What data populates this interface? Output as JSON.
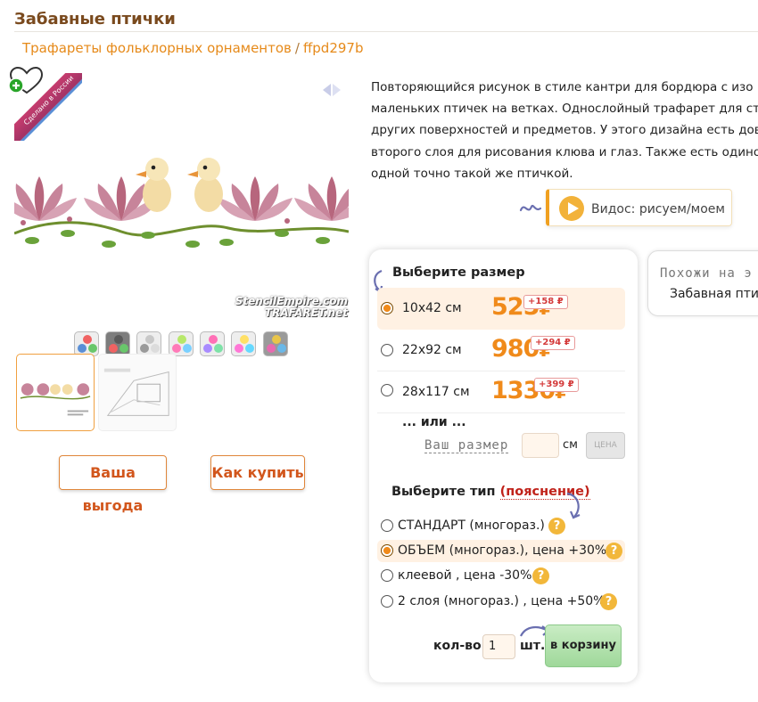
{
  "header": {
    "title": "Забавные птички",
    "breadcrumb": {
      "category": "Трафареты фольклорных орнаментов",
      "separator": "/",
      "sku": "ffpd297b"
    }
  },
  "gallery": {
    "ribbon_text": "Сделано в России",
    "watermark_line1": "StencilEmpire.com",
    "watermark_line2": "TRAFARET.net",
    "swatches": [
      [
        "#f06262",
        "#5a8fd6",
        "#69c76b"
      ],
      [
        "#5a5a5a",
        "#f06262",
        "#69c76b"
      ],
      [
        "#c8c8c8",
        "#9a9a9a",
        "#dcdcdc"
      ],
      [
        "#b7e86a",
        "#ff7ab8",
        "#7ad0ff"
      ],
      [
        "#ff6fb6",
        "#a98bff",
        "#7ee2a8"
      ],
      [
        "#ffe066",
        "#ff77d6",
        "#66d9ff"
      ],
      [
        "#e8c54a",
        "#e86ab0",
        "#6ab8e8"
      ]
    ],
    "thumb_caption": "Забавные птички"
  },
  "buttons": {
    "benefit": "Ваша выгода",
    "how_to_buy": "Как купить"
  },
  "description": {
    "lines": [
      "Повторяющийся рисунок в стиле кантри для бордюра с изо",
      "маленьких птичек на ветках. Однослойный трафарет для ст",
      "других поверхностей и предметов. У этого дизайна есть дов",
      "второго слоя для рисования клюва и глаз. Также есть одинос",
      "одной точно такой же птичкой."
    ]
  },
  "video": {
    "label": "Видос: рисуем/моем"
  },
  "order": {
    "size_heading": "Выберите размер",
    "sizes": [
      {
        "label": "10х42 см",
        "price": "525",
        "currency": "₽",
        "markup": "+158 ₽",
        "selected": true
      },
      {
        "label": "22х92 см",
        "price": "980",
        "currency": "₽",
        "markup": "+294 ₽",
        "selected": false
      },
      {
        "label": "28х117 см",
        "price": "1330",
        "currency": "₽",
        "markup": "+399 ₽",
        "selected": false
      }
    ],
    "or_label": "... или ...",
    "own_size_label": "Ваш размер",
    "own_size_value": "",
    "cm_label": "см",
    "price_button": "ЦЕНА",
    "type_heading": "Выберите тип",
    "type_hint": "(пояснение)",
    "types": [
      {
        "label": "СТАНДАРТ (многораз.)",
        "selected": false
      },
      {
        "label": "ОБЪЕМ (многораз.), цена +30%",
        "selected": true
      },
      {
        "label": "клеевой , цена -30%",
        "selected": false
      },
      {
        "label": "2 слоя (многораз.) , цена +50%",
        "selected": false
      }
    ],
    "help_glyph": "?",
    "qty_label": "кол-во:",
    "qty_value": "1",
    "pcs_label": "шт.",
    "cart_button": "в корзину"
  },
  "similar": {
    "heading": "Похожи на э",
    "item": "Забавная птич"
  },
  "colors": {
    "accent": "#f08a1a",
    "title": "#7a4a1e",
    "link": "#e68a1a",
    "cart": "#a8dca3"
  }
}
